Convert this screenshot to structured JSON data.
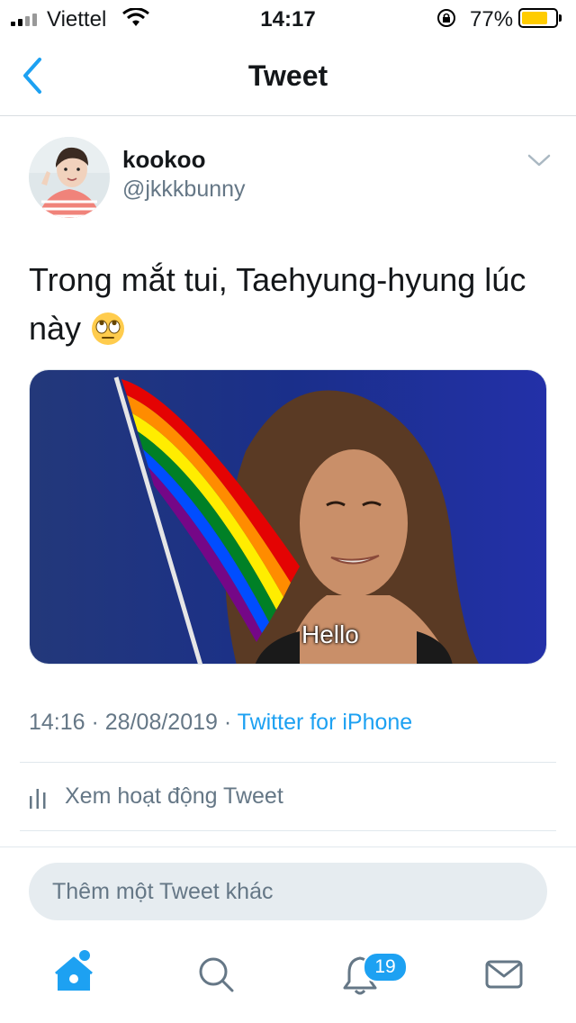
{
  "status_bar": {
    "carrier": "Viettel",
    "time": "14:17",
    "battery_percent": "77%",
    "battery_level": 0.77,
    "icons": [
      "signal-icon",
      "wifi-icon",
      "orientation-lock-icon",
      "battery-icon"
    ]
  },
  "nav": {
    "title": "Tweet",
    "back_icon": "chevron-left-icon"
  },
  "tweet": {
    "author_name": "kookoo",
    "author_handle": "@jkkkbunny",
    "text": "Trong mắt tui, Taehyung-hyung lúc này",
    "emoji": "eye-roll-emoji",
    "media_caption": "Hello",
    "time": "14:16",
    "date": "28/08/2019",
    "separator": " · ",
    "client": "Twitter for iPhone",
    "activity_label": "Xem hoạt động Tweet"
  },
  "reply": {
    "placeholder": "Thêm một Tweet khác"
  },
  "tabbar": {
    "items": [
      "home-icon",
      "search-icon",
      "notifications-icon",
      "messages-icon"
    ],
    "notification_count": "19"
  },
  "colors": {
    "accent": "#1da1f2",
    "secondary_text": "#657786",
    "battery": "#ffcc00"
  }
}
